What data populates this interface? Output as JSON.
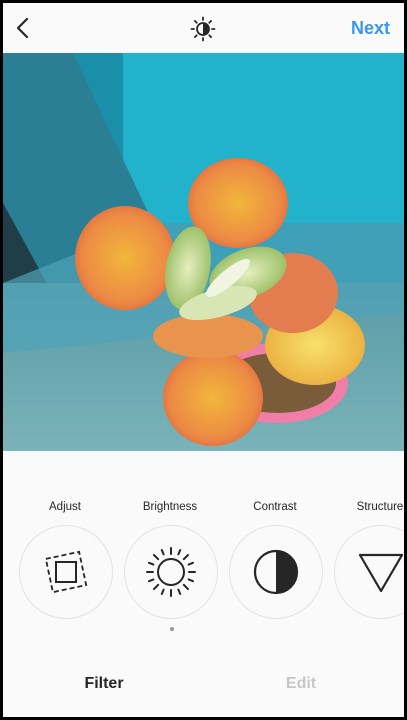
{
  "header": {
    "back_icon": "chevron-left-icon",
    "lux_icon": "lux-sun-icon",
    "next_label": "Next"
  },
  "colors": {
    "accent": "#3897f0",
    "text": "#262626",
    "inactive": "#c7c7c7",
    "background": "#fafafa"
  },
  "tools": [
    {
      "label": "Adjust",
      "icon": "adjust-icon"
    },
    {
      "label": "Brightness",
      "icon": "sun-icon"
    },
    {
      "label": "Contrast",
      "icon": "contrast-icon"
    },
    {
      "label": "Structure",
      "icon": "triangle-icon"
    }
  ],
  "tabs": [
    {
      "label": "Filter",
      "active": true
    },
    {
      "label": "Edit",
      "active": false
    }
  ]
}
